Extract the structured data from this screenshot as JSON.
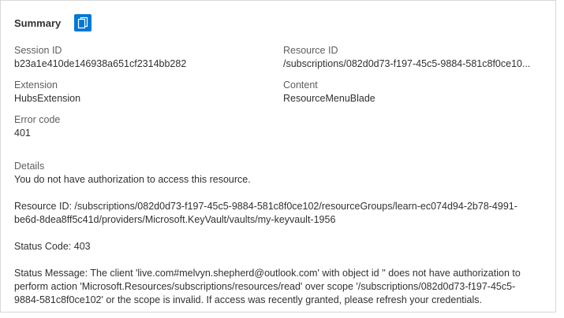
{
  "summary": {
    "title": "Summary",
    "copy_icon": "copy-icon"
  },
  "fields": {
    "session_id": {
      "label": "Session ID",
      "value": "b23a1e410de146938a651cf2314bb282"
    },
    "resource_id": {
      "label": "Resource ID",
      "value": "/subscriptions/082d0d73-f197-45c5-9884-581c8f0ce10..."
    },
    "extension": {
      "label": "Extension",
      "value": "HubsExtension"
    },
    "content": {
      "label": "Content",
      "value": "ResourceMenuBlade"
    },
    "error_code": {
      "label": "Error code",
      "value": "401"
    }
  },
  "details": {
    "label": "Details",
    "message": "You do not have authorization to access this resource.",
    "resource_id_line1": "Resource ID: /subscriptions/082d0d73-f197-45c5-9884-581c8f0ce102/resourceGroups/learn-ec074d94-2b78-4991-",
    "resource_id_line2": "be6d-8dea8ff5c41d/providers/Microsoft.KeyVault/vaults/my-keyvault-1956",
    "status_code": "Status Code: 403",
    "status_message_line1": "Status Message: The client 'live.com#melvyn.shepherd@outlook.com' with object id '' does not have authorization to",
    "status_message_line2": "perform action 'Microsoft.Resources/subscriptions/resources/read' over scope '/subscriptions/082d0d73-f197-45c5-",
    "status_message_line3": "9884-581c8f0ce102' or the scope is invalid. If access was recently granted, please refresh your credentials."
  },
  "colors": {
    "accent": "#0078d4",
    "text": "#323130",
    "label": "#605e5c",
    "border": "#d8d8d8"
  }
}
